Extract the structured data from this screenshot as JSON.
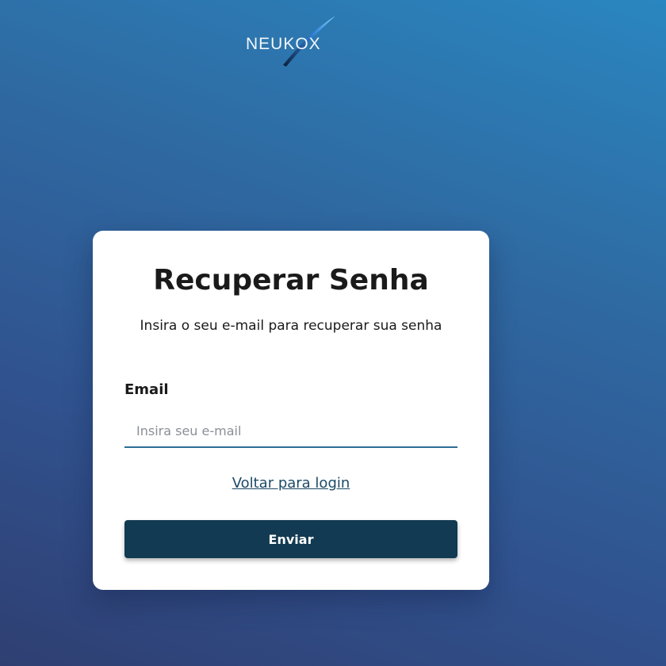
{
  "logo": {
    "text": "NEUKOX",
    "icon": "logo-swoosh-icon",
    "accent_color": "#4fb0ff"
  },
  "card": {
    "title": "Recuperar Senha",
    "subtitle": "Insira o seu e-mail para recuperar sua senha"
  },
  "form": {
    "email_label": "Email",
    "email_placeholder": "Insira seu e-mail",
    "email_value": "",
    "back_link_label": "Voltar para login",
    "submit_label": "Enviar"
  },
  "colors": {
    "background_top": "#2a86c0",
    "background_bottom": "#2f3f72",
    "button": "#123a52",
    "input_underline": "#2b6d96",
    "link": "#1c4a66"
  }
}
